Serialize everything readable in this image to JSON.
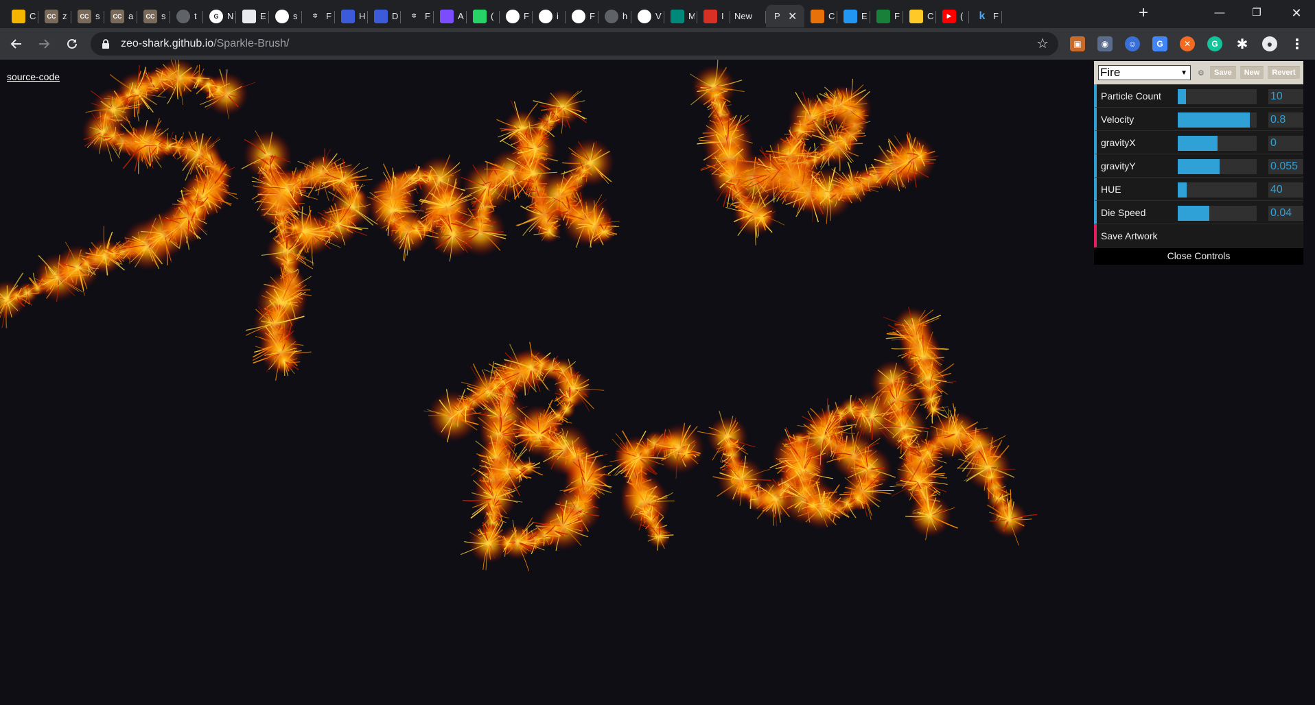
{
  "browser": {
    "tabs": [
      {
        "icon": "slides-icon",
        "color": "#f4b400",
        "text": "C",
        "glyph": ""
      },
      {
        "icon": "cc-icon",
        "color": "#7a6a5a",
        "text": "z",
        "glyph": "CC"
      },
      {
        "icon": "cc-icon",
        "color": "#7a6a5a",
        "text": "s",
        "glyph": "CC"
      },
      {
        "icon": "cc-icon",
        "color": "#7a6a5a",
        "text": "a",
        "glyph": "CC"
      },
      {
        "icon": "cc-icon",
        "color": "#7a6a5a",
        "text": "s",
        "glyph": "CC"
      },
      {
        "icon": "globe-icon",
        "color": "#5f6368",
        "text": "t",
        "glyph": ""
      },
      {
        "icon": "google-icon",
        "color": "#ffffff",
        "text": "N",
        "glyph": "G"
      },
      {
        "icon": "notebook-icon",
        "color": "#e8eaed",
        "text": "E",
        "glyph": ""
      },
      {
        "icon": "github-icon",
        "color": "#ffffff",
        "text": "s",
        "glyph": ""
      },
      {
        "icon": "openai-icon",
        "color": "#202124",
        "text": "F",
        "glyph": "✲"
      },
      {
        "icon": "deepnote-icon",
        "color": "#3b5bdb",
        "text": "H",
        "glyph": ""
      },
      {
        "icon": "deepnote-icon",
        "color": "#3b5bdb",
        "text": "D",
        "glyph": ""
      },
      {
        "icon": "openai-icon",
        "color": "#202124",
        "text": "F",
        "glyph": "✲"
      },
      {
        "icon": "drop-icon",
        "color": "#7c4dff",
        "text": "A",
        "glyph": ""
      },
      {
        "icon": "whatsapp-icon",
        "color": "#25d366",
        "text": "(",
        "glyph": ""
      },
      {
        "icon": "github-icon",
        "color": "#ffffff",
        "text": "F",
        "glyph": ""
      },
      {
        "icon": "github-icon",
        "color": "#ffffff",
        "text": "i",
        "glyph": ""
      },
      {
        "icon": "github-icon",
        "color": "#ffffff",
        "text": "F",
        "glyph": ""
      },
      {
        "icon": "globe-icon",
        "color": "#5f6368",
        "text": "h",
        "glyph": ""
      },
      {
        "icon": "github-icon",
        "color": "#ffffff",
        "text": "V",
        "glyph": ""
      },
      {
        "icon": "meet-icon",
        "color": "#00897b",
        "text": "M",
        "glyph": ""
      },
      {
        "icon": "signal-icon",
        "color": "#d93025",
        "text": "I",
        "glyph": ""
      }
    ],
    "newtab_label": "New",
    "active_tab_text": "P",
    "tabs_after": [
      {
        "icon": "sparkle-icon",
        "color": "#e8710a",
        "text": "C",
        "glyph": ""
      },
      {
        "icon": "flutter-icon",
        "color": "#2196f3",
        "text": "E",
        "glyph": ""
      },
      {
        "icon": "chart-icon",
        "color": "#188038",
        "text": "F",
        "glyph": ""
      },
      {
        "icon": "firebase-icon",
        "color": "#ffca28",
        "text": "C",
        "glyph": ""
      },
      {
        "icon": "youtube-icon",
        "color": "#ff0000",
        "text": "(",
        "glyph": "▶"
      },
      {
        "icon": "k-icon",
        "color": "#202124",
        "text": "F",
        "glyph": "k"
      }
    ],
    "url_domain": "zeo-shark.github.io",
    "url_path": "/Sparkle-Brush/"
  },
  "page": {
    "source_link": "source-code"
  },
  "gui": {
    "preset": "Fire",
    "save_label": "Save",
    "new_label": "New",
    "revert_label": "Revert",
    "controls": [
      {
        "label": "Particle Count",
        "value": "10",
        "fill": 0.1
      },
      {
        "label": "Velocity",
        "value": "0.8",
        "fill": 0.91
      },
      {
        "label": "gravityX",
        "value": "0",
        "fill": 0.5
      },
      {
        "label": "gravityY",
        "value": "0.055",
        "fill": 0.53
      },
      {
        "label": "HUE",
        "value": "40",
        "fill": 0.11
      },
      {
        "label": "Die Speed",
        "value": "0.04",
        "fill": 0.4
      }
    ],
    "save_artwork_label": "Save Artwork",
    "close_label": "Close Controls",
    "accent_color": "#2fa1d6",
    "function_color": "#e61d5f"
  },
  "artwork": {
    "text_lines": [
      "Sparkle",
      "Brush"
    ],
    "colors": {
      "core": "#ffd23a",
      "mid": "#ff8a00",
      "edge": "#c81e00"
    }
  }
}
